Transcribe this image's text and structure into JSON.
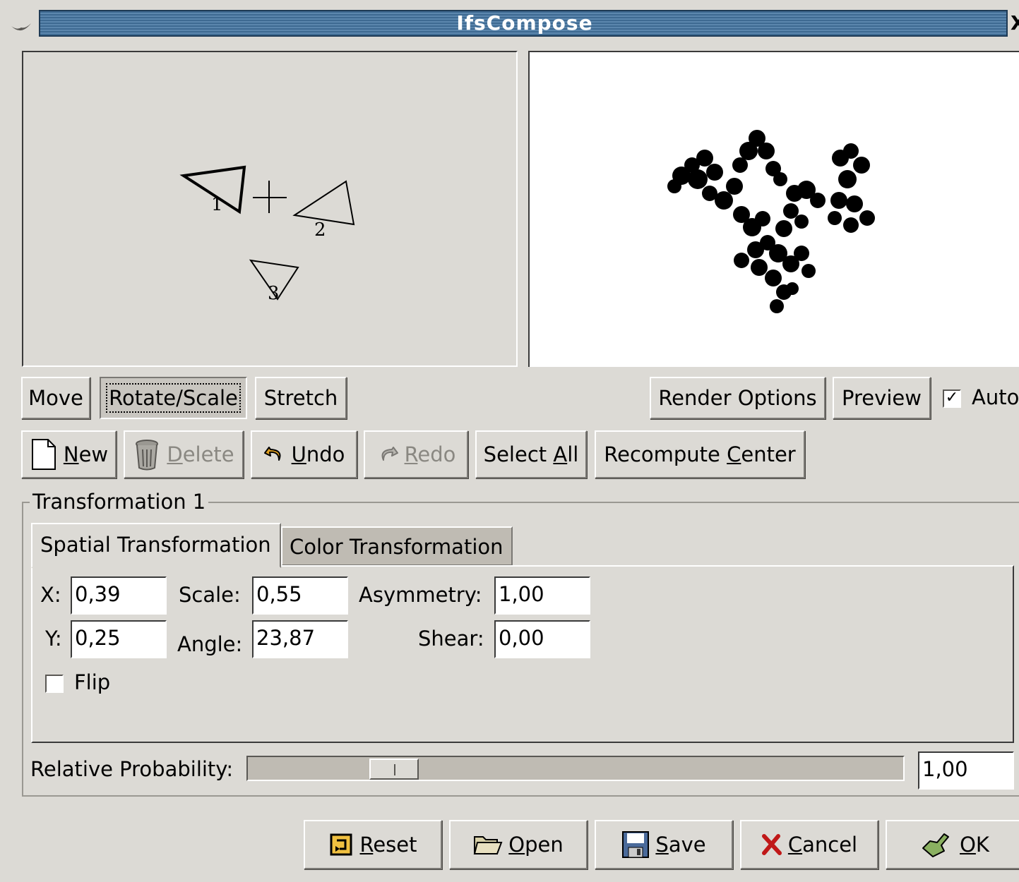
{
  "window": {
    "title": "IfsCompose"
  },
  "design": {
    "triangles": [
      {
        "label": "1"
      },
      {
        "label": "2"
      },
      {
        "label": "3"
      }
    ]
  },
  "toolbar1": {
    "move": "Move",
    "rotate_scale": "Rotate/Scale",
    "stretch": "Stretch",
    "render_options": "Render Options",
    "preview": "Preview",
    "auto": "Auto",
    "auto_checked": true,
    "active_mode": "Rotate/Scale"
  },
  "toolbar2": {
    "new": {
      "mnemonic": "N",
      "rest": "ew"
    },
    "delete": {
      "mnemonic": "D",
      "rest": "elete"
    },
    "undo": {
      "mnemonic": "U",
      "rest": "ndo"
    },
    "redo": {
      "mnemonic": "R",
      "rest": "edo"
    },
    "select_all": {
      "pre": "Select ",
      "mnemonic": "A",
      "rest": "ll"
    },
    "recompute_center": {
      "pre": "Recompute ",
      "mnemonic": "C",
      "rest": "enter"
    }
  },
  "transformation": {
    "frame_title": "Transformation 1",
    "tabs": [
      "Spatial Transformation",
      "Color Transformation"
    ],
    "active_tab": "Spatial Transformation",
    "x_label": "X:",
    "x": "0,39",
    "y_label": "Y:",
    "y": "0,25",
    "scale_label": "Scale:",
    "scale": "0,55",
    "angle_label": "Angle:",
    "angle": "23,87",
    "asymmetry_label": "Asymmetry:",
    "asymmetry": "1,00",
    "shear_label": "Shear:",
    "shear": "0,00",
    "flip_label": "Flip",
    "flip_checked": false
  },
  "probability": {
    "label": "Relative Probability:",
    "value": "1,00",
    "slider_fraction": 0.2
  },
  "footer": {
    "reset": {
      "mnemonic": "R",
      "rest": "eset"
    },
    "open": {
      "mnemonic": "O",
      "rest": "pen"
    },
    "save": {
      "mnemonic": "S",
      "rest": "ave"
    },
    "cancel": {
      "mnemonic": "C",
      "rest": "ancel"
    },
    "ok": {
      "mnemonic": "O",
      "rest": "K"
    }
  },
  "icons": {
    "window_menu": "gimp-icon",
    "close": "close-icon",
    "new": "document-icon",
    "delete": "trash-icon",
    "undo": "undo-icon",
    "redo": "redo-icon",
    "reset": "reset-icon",
    "open": "folder-icon",
    "save": "floppy-icon",
    "cancel": "cancel-icon",
    "ok": "ok-icon"
  }
}
